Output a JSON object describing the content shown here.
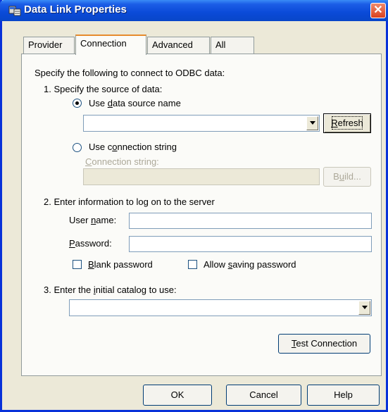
{
  "window": {
    "title": "Data Link Properties",
    "close_glyph": "✕"
  },
  "tabs": [
    {
      "label": "Provider",
      "selected": false
    },
    {
      "label": "Connection",
      "selected": true
    },
    {
      "label": "Advanced",
      "selected": false
    },
    {
      "label": "All",
      "selected": false
    }
  ],
  "connection": {
    "intro": "Specify the following to connect to ODBC data:",
    "step1": "1. Specify the source of data:",
    "use_dsn_pre": "Use ",
    "use_dsn_key": "d",
    "use_dsn_post": "ata source name",
    "dsn_value": "",
    "refresh_key": "R",
    "refresh_post": "efresh",
    "use_cs_pre": "Use c",
    "use_cs_key": "o",
    "use_cs_post": "nnection string",
    "cs_label_pre": "",
    "cs_label_key": "C",
    "cs_label_post": "onnection string:",
    "cs_value": "",
    "build_pre": "B",
    "build_key": "u",
    "build_post": "ild...",
    "step2": "2. Enter information to log on to the server",
    "user_pre": "User ",
    "user_key": "n",
    "user_post": "ame:",
    "user_value": "",
    "pw_key": "P",
    "pw_post": "assword:",
    "pw_value": "",
    "blank_key": "B",
    "blank_post": "lank password",
    "allow_pre": "Allow ",
    "allow_key": "s",
    "allow_post": "aving password",
    "step3_pre": "3. Enter the ",
    "step3_key": "i",
    "step3_post": "nitial catalog to use:",
    "catalog_value": "",
    "test_key": "T",
    "test_post": "est Connection"
  },
  "footer": {
    "ok": "OK",
    "cancel": "Cancel",
    "help": "Help"
  }
}
